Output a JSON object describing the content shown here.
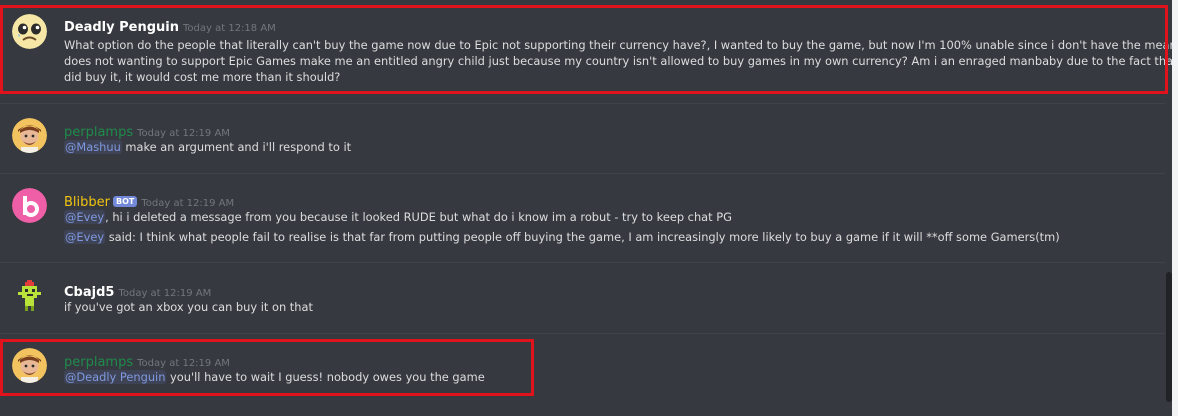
{
  "colors": {
    "background": "#36393f",
    "highlight_border": "#e0131c",
    "mention": "#7f98e0",
    "perplamps_name": "#1f8b4c",
    "blibber_name": "#f1c40f",
    "default_name": "#ffffff"
  },
  "messages": [
    {
      "author": "Deadly Penguin",
      "timestamp": "Today at 12:18 AM",
      "avatar_icon": "crying-face-icon",
      "lines": [
        "What option do the people that literally can't buy the game now due to Epic not supporting their currency have?, I wanted to buy the game, but now I'm 100% unable since i don't have the means to do so,",
        "does not wanting to support Epic Games make me an entitled angry child just because my country isn't allowed to buy games in my own currency? Am i an enraged manbaby due to the fact that even if i",
        "did buy it, it would cost me more than it should?"
      ]
    },
    {
      "author": "perplamps",
      "timestamp": "Today at 12:19 AM",
      "avatar_icon": "cartoon-person-icon",
      "mention": "@Mashuu",
      "text": " make an argument and i'll respond to it"
    },
    {
      "author": "Blibber",
      "badge": "BOT",
      "timestamp": "Today at 12:19 AM",
      "avatar_icon": "pink-b-logo-icon",
      "line1_mention": "@Evey",
      "line1_text": ", hi i deleted a message from you because it looked RUDE but what do i know im a robut - try to keep chat PG",
      "line2_mention": "@Evey",
      "line2_text": " said: I think what people fail to realise is that far from putting people off buying the game, I am increasingly more likely to buy a game if it will  **off some Gamers(tm)"
    },
    {
      "author": "Cbajd5",
      "timestamp": "Today at 12:19 AM",
      "avatar_icon": "pixel-character-icon",
      "text": "if you've got an xbox you can buy it on that"
    },
    {
      "author": "perplamps",
      "timestamp": "Today at 12:19 AM",
      "avatar_icon": "cartoon-person-icon",
      "mention": "@Deadly Penguin",
      "text": " you'll have to wait I guess! nobody owes you the game"
    }
  ]
}
